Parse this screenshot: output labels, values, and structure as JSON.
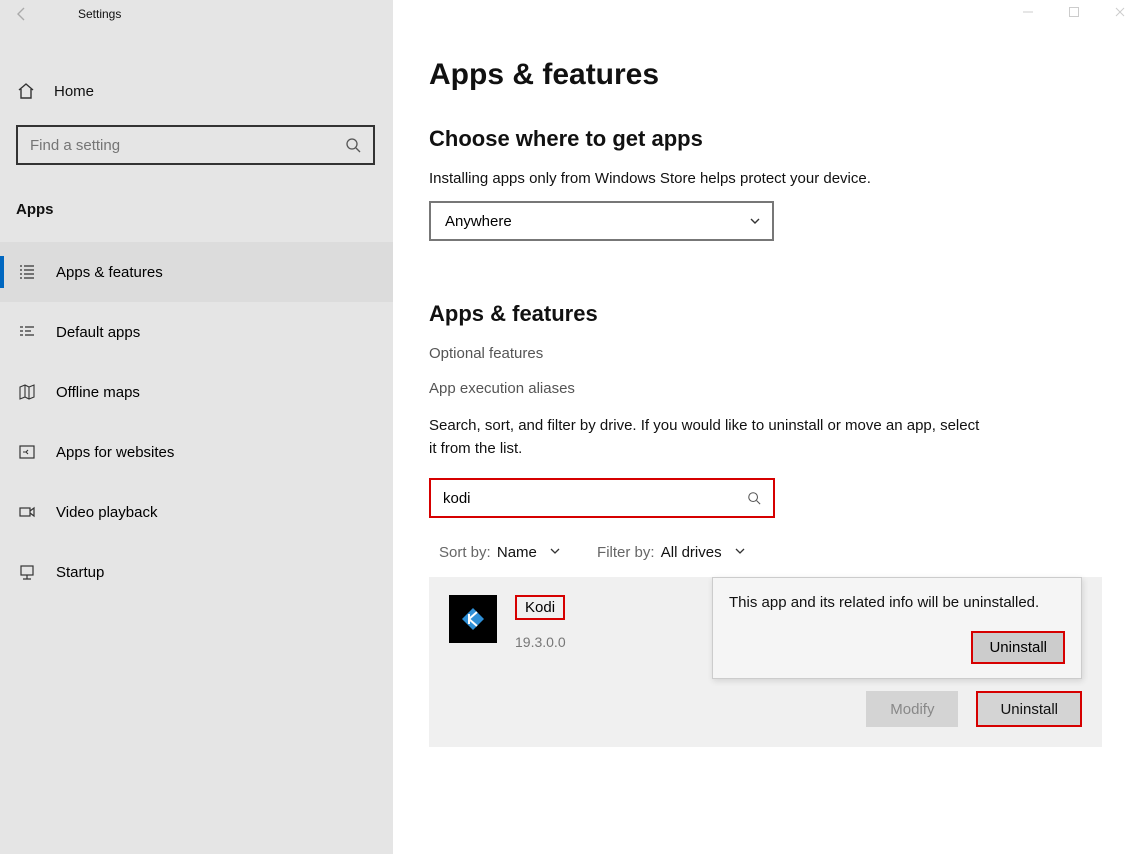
{
  "window": {
    "title": "Settings"
  },
  "sidebar": {
    "home": "Home",
    "search_placeholder": "Find a setting",
    "section_label": "Apps",
    "items": [
      {
        "label": "Apps & features",
        "icon": "list-icon",
        "active": true
      },
      {
        "label": "Default apps",
        "icon": "defaults-icon"
      },
      {
        "label": "Offline maps",
        "icon": "map-icon"
      },
      {
        "label": "Apps for websites",
        "icon": "web-icon"
      },
      {
        "label": "Video playback",
        "icon": "video-icon"
      },
      {
        "label": "Startup",
        "icon": "startup-icon"
      }
    ]
  },
  "main": {
    "heading": "Apps & features",
    "choose_heading": "Choose where to get apps",
    "choose_desc": "Installing apps only from Windows Store helps protect your device.",
    "source_selected": "Anywhere",
    "subheading": "Apps & features",
    "optional_link": "Optional features",
    "aliases_link": "App execution aliases",
    "instructions": "Search, sort, and filter by drive. If you would like to uninstall or move an app, select it from the list.",
    "app_search_value": "kodi",
    "sort_label": "Sort by:",
    "sort_value": "Name",
    "filter_label": "Filter by:",
    "filter_value": "All drives",
    "selected_app": {
      "name": "Kodi",
      "version": "19.3.0.0"
    },
    "modify_label": "Modify",
    "uninstall_label": "Uninstall",
    "flyout_text": "This app and its related info will be uninstalled.",
    "flyout_button": "Uninstall"
  }
}
